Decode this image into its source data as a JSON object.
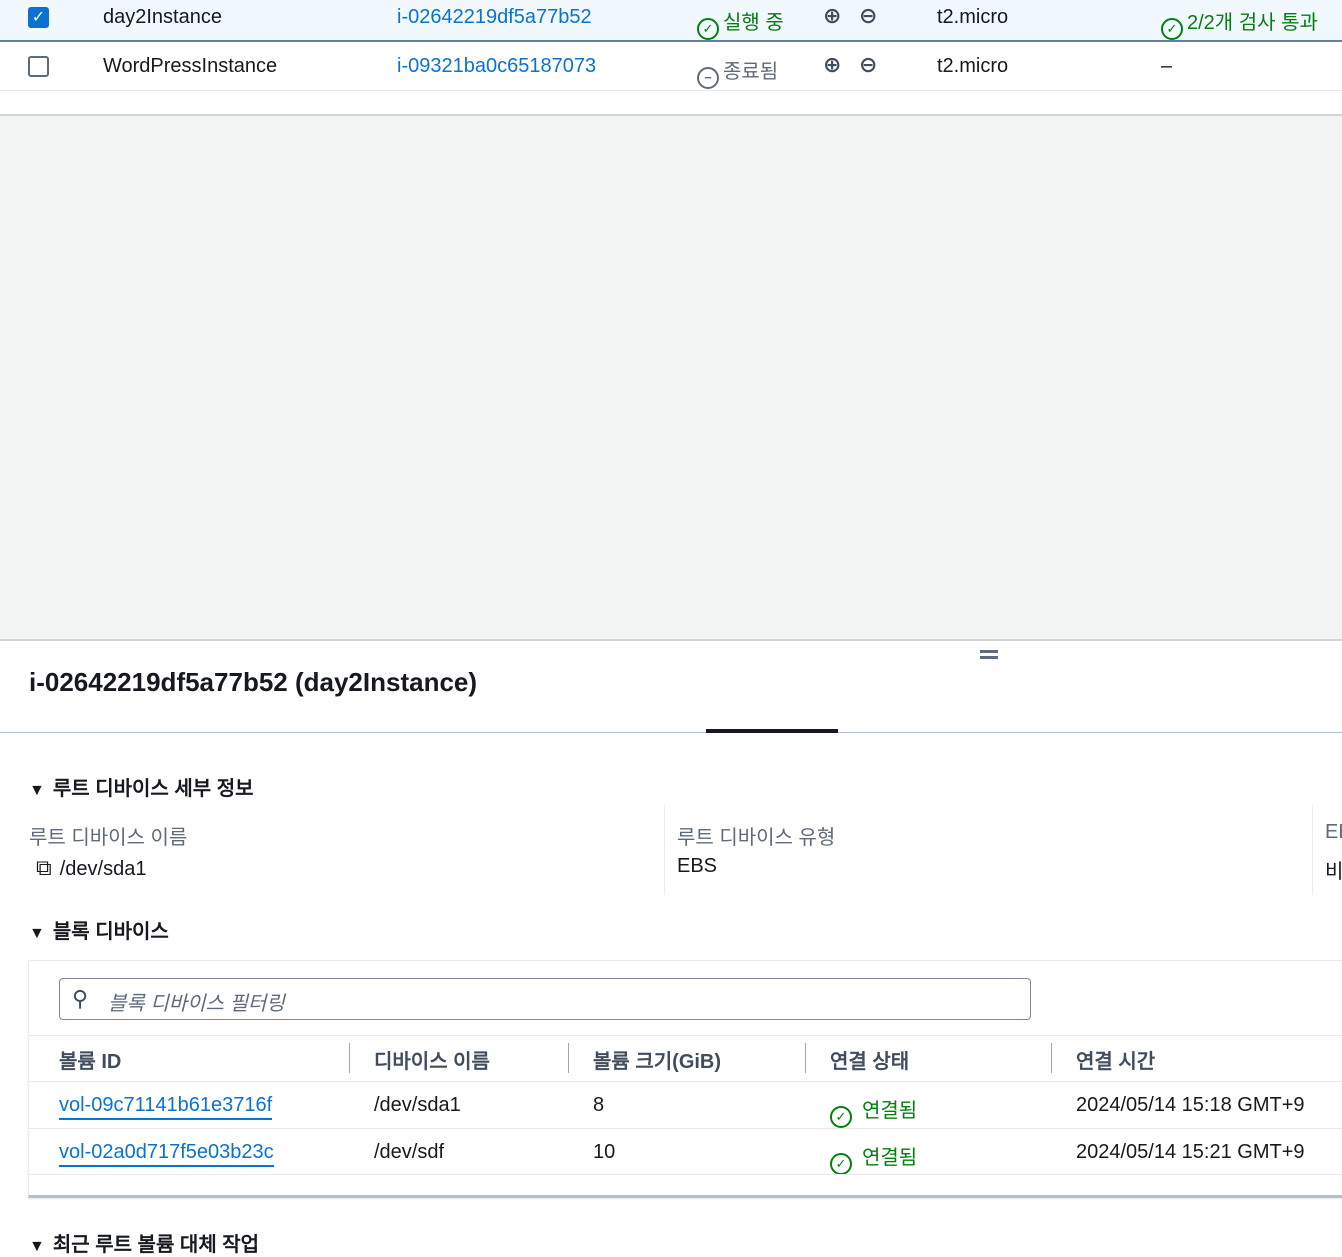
{
  "instances": [
    {
      "selected": true,
      "name": "day2Instance",
      "id": "i-02642219df5a77b52",
      "state": "실행 중",
      "state_kind": "running",
      "type": "t2.micro",
      "checks": "2/2개 검사 통과"
    },
    {
      "selected": false,
      "name": "WordPressInstance",
      "id": "i-09321ba0c65187073",
      "state": "종료됨",
      "state_kind": "terminated",
      "type": "t2.micro",
      "checks": "–"
    }
  ],
  "details": {
    "title": "i-02642219df5a77b52 (day2Instance)",
    "root_section": "루트 디바이스 세부 정보",
    "root_name_label": "루트 디바이스 이름",
    "root_name_value": "/dev/sda1",
    "root_type_label": "루트 디바이스 유형",
    "root_type_value": "EBS",
    "third_label_partial": "EB",
    "third_value_partial": "비",
    "block_section": "블록 디바이스",
    "filter_placeholder": "블록 디바이스 필터링",
    "columns": [
      "볼륨 ID",
      "디바이스 이름",
      "볼륨 크기(GiB)",
      "연결 상태",
      "연결 시간"
    ],
    "rows": [
      [
        "vol-09c71141b61e3716f",
        "/dev/sda1",
        "8",
        "연결됨",
        "2024/05/14 15:18 GMT+9"
      ],
      [
        "vol-02a0d717f5e03b23c",
        "/dev/sdf",
        "10",
        "연결됨",
        "2024/05/14 15:21 GMT+9"
      ]
    ],
    "next_section": "최근 루트 볼륨 대체 작업"
  },
  "colors": {
    "link": "#0972d3",
    "success": "#037f0c",
    "selected_row": "#f1f8fe"
  }
}
